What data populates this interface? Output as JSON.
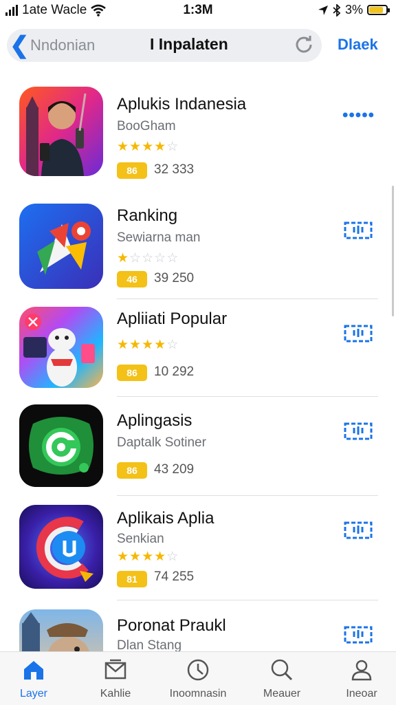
{
  "status_bar": {
    "carrier": "1ate Wacle",
    "time": "1:3M",
    "battery": "3%",
    "battery_level_percent": 85
  },
  "nav": {
    "back_label": "Nndonian",
    "title": "I Inpalaten",
    "action_label": "Dlaek"
  },
  "apps": [
    {
      "name": "Aplukis Indanesia",
      "subtitle": "BooGham",
      "rating": 4,
      "badge": "86",
      "count": "32 333",
      "button": "more"
    },
    {
      "name": "Ranking",
      "subtitle": "Sewiarna man",
      "rating": 1,
      "badge": "46",
      "count": "39 250",
      "button": "get"
    },
    {
      "name": "Apliiati Popular",
      "subtitle": "",
      "rating": 4,
      "badge": "86",
      "count": "10 292",
      "button": "get"
    },
    {
      "name": "Aplingasis",
      "subtitle": "Daptalk Sotiner",
      "rating": 0,
      "badge": "86",
      "count": "43 209",
      "button": "get"
    },
    {
      "name": "Aplikais Aplia",
      "subtitle": "Senkian",
      "rating": 4,
      "badge": "81",
      "count": "74 255",
      "button": "get"
    },
    {
      "name": "Poronat Praukl",
      "subtitle": "Dlan Stang",
      "rating": 0,
      "badge": "",
      "count": "",
      "button": "get"
    }
  ],
  "tabs": [
    {
      "label": "Layer",
      "icon": "home-icon",
      "active": true
    },
    {
      "label": "Kahlie",
      "icon": "mail-icon",
      "active": false
    },
    {
      "label": "Inoomnasin",
      "icon": "clock-icon",
      "active": false
    },
    {
      "label": "Meauer",
      "icon": "search-icon",
      "active": false
    },
    {
      "label": "Ineoar",
      "icon": "person-icon",
      "active": false
    }
  ],
  "colors": {
    "accent": "#1a73e8",
    "star": "#f5b800",
    "badge": "#f3c118"
  }
}
